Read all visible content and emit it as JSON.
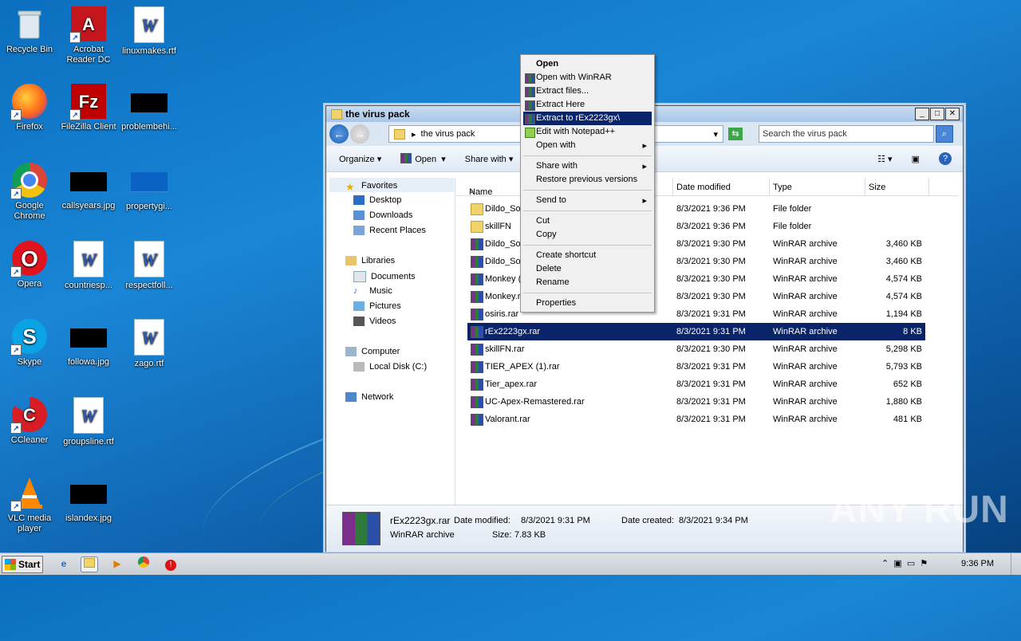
{
  "desktop": {
    "icons": [
      {
        "label": "Recycle Bin"
      },
      {
        "label": "Acrobat Reader DC"
      },
      {
        "label": "linuxmakes.rtf"
      },
      {
        "label": "Firefox"
      },
      {
        "label": "FileZilla Client"
      },
      {
        "label": "problembehi..."
      },
      {
        "label": "Google Chrome"
      },
      {
        "label": "callsyears.jpg"
      },
      {
        "label": "propertygi..."
      },
      {
        "label": "Opera"
      },
      {
        "label": "countriesp..."
      },
      {
        "label": "respectfoll..."
      },
      {
        "label": "Skype"
      },
      {
        "label": "followa.jpg"
      },
      {
        "label": "zago.rtf"
      },
      {
        "label": "CCleaner"
      },
      {
        "label": "groupsline.rtf"
      },
      {
        "label": "VLC media player"
      },
      {
        "label": "islandex.jpg"
      }
    ]
  },
  "window": {
    "title": "the virus pack",
    "address": "the virus pack",
    "search_placeholder": "Search the virus pack",
    "toolbar": {
      "organize": "Organize",
      "open": "Open",
      "share_with": "Share with"
    },
    "nav": {
      "favorites": "Favorites",
      "desktop": "Desktop",
      "downloads": "Downloads",
      "recent": "Recent Places",
      "libraries": "Libraries",
      "documents": "Documents",
      "music": "Music",
      "pictures": "Pictures",
      "videos": "Videos",
      "computer": "Computer",
      "local_disk": "Local Disk (C:)",
      "network": "Network"
    },
    "columns": {
      "name": "Name",
      "date": "Date modified",
      "type": "Type",
      "size": "Size"
    },
    "files": [
      {
        "name": "Dildo_Sof",
        "date": "8/3/2021 9:36 PM",
        "type": "File folder",
        "size": "",
        "kind": "folder"
      },
      {
        "name": "skillFN",
        "date": "8/3/2021 9:36 PM",
        "type": "File folder",
        "size": "",
        "kind": "folder"
      },
      {
        "name": "Dildo_Sof",
        "date": "8/3/2021 9:30 PM",
        "type": "WinRAR archive",
        "size": "3,460 KB",
        "kind": "rar"
      },
      {
        "name": "Dildo_Sof",
        "date": "8/3/2021 9:30 PM",
        "type": "WinRAR archive",
        "size": "3,460 KB",
        "kind": "rar"
      },
      {
        "name": "Monkey (",
        "date": "8/3/2021 9:30 PM",
        "type": "WinRAR archive",
        "size": "4,574 KB",
        "kind": "rar"
      },
      {
        "name": "Monkey.r",
        "date": "8/3/2021 9:30 PM",
        "type": "WinRAR archive",
        "size": "4,574 KB",
        "kind": "rar"
      },
      {
        "name": "osiris.rar",
        "date": "8/3/2021 9:31 PM",
        "type": "WinRAR archive",
        "size": "1,194 KB",
        "kind": "rar"
      },
      {
        "name": "rEx2223gx.rar",
        "date": "8/3/2021 9:31 PM",
        "type": "WinRAR archive",
        "size": "8 KB",
        "kind": "rar",
        "selected": true
      },
      {
        "name": "skillFN.rar",
        "date": "8/3/2021 9:30 PM",
        "type": "WinRAR archive",
        "size": "5,298 KB",
        "kind": "rar"
      },
      {
        "name": "TIER_APEX (1).rar",
        "date": "8/3/2021 9:31 PM",
        "type": "WinRAR archive",
        "size": "5,793 KB",
        "kind": "rar"
      },
      {
        "name": "Tier_apex.rar",
        "date": "8/3/2021 9:31 PM",
        "type": "WinRAR archive",
        "size": "652 KB",
        "kind": "rar"
      },
      {
        "name": "UC-Apex-Remastered.rar",
        "date": "8/3/2021 9:31 PM",
        "type": "WinRAR archive",
        "size": "1,880 KB",
        "kind": "rar"
      },
      {
        "name": "Valorant.rar",
        "date": "8/3/2021 9:31 PM",
        "type": "WinRAR archive",
        "size": "481 KB",
        "kind": "rar"
      }
    ],
    "details": {
      "name": "rEx2223gx.rar",
      "type": "WinRAR archive",
      "modified_label": "Date modified:",
      "modified": "8/3/2021 9:31 PM",
      "size_label": "Size:",
      "size": "7.83 KB",
      "created_label": "Date created:",
      "created": "8/3/2021 9:34 PM"
    }
  },
  "context_menu": {
    "items": [
      {
        "label": "Open"
      },
      {
        "label": "Open with WinRAR"
      },
      {
        "label": "Extract files..."
      },
      {
        "label": "Extract Here"
      },
      {
        "label": "Extract to rEx2223gx\\"
      },
      {
        "label": "Edit with Notepad++"
      },
      {
        "label": "Open with"
      },
      {
        "label": "Share with"
      },
      {
        "label": "Restore previous versions"
      },
      {
        "label": "Send to"
      },
      {
        "label": "Cut"
      },
      {
        "label": "Copy"
      },
      {
        "label": "Create shortcut"
      },
      {
        "label": "Delete"
      },
      {
        "label": "Rename"
      },
      {
        "label": "Properties"
      }
    ]
  },
  "taskbar": {
    "start": "Start",
    "clock": "9:36 PM"
  },
  "watermark": "ANY RUN"
}
